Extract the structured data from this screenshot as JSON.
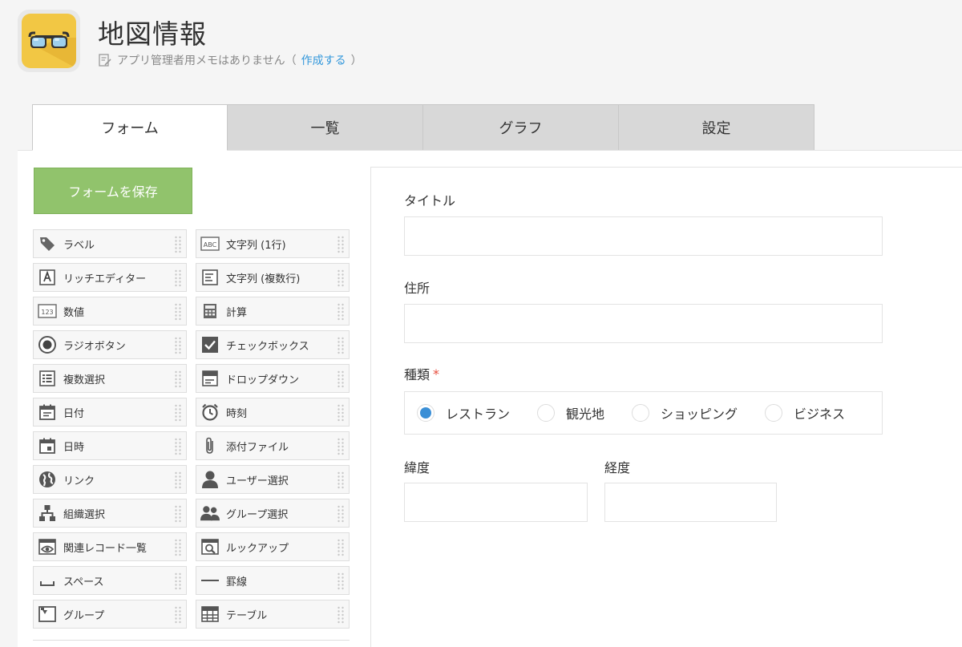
{
  "header": {
    "app_title": "地図情報",
    "memo_text": "アプリ管理者用メモはありません（",
    "memo_link": "作成する",
    "memo_close": "）"
  },
  "tabs": [
    {
      "label": "フォーム",
      "active": true
    },
    {
      "label": "一覧",
      "active": false
    },
    {
      "label": "グラフ",
      "active": false
    },
    {
      "label": "設定",
      "active": false
    }
  ],
  "toolbar": {
    "save_label": "フォームを保存"
  },
  "palette": [
    {
      "label": "ラベル",
      "icon": "tag-icon"
    },
    {
      "label": "文字列 (1行)",
      "icon": "abc-icon"
    },
    {
      "label": "リッチエディター",
      "icon": "rich-editor-icon"
    },
    {
      "label": "文字列 (複数行)",
      "icon": "multiline-text-icon"
    },
    {
      "label": "数値",
      "icon": "number-icon"
    },
    {
      "label": "計算",
      "icon": "calculator-icon"
    },
    {
      "label": "ラジオボタン",
      "icon": "radio-icon"
    },
    {
      "label": "チェックボックス",
      "icon": "checkbox-icon"
    },
    {
      "label": "複数選択",
      "icon": "multi-select-icon"
    },
    {
      "label": "ドロップダウン",
      "icon": "dropdown-icon"
    },
    {
      "label": "日付",
      "icon": "calendar-icon"
    },
    {
      "label": "時刻",
      "icon": "clock-icon"
    },
    {
      "label": "日時",
      "icon": "datetime-icon"
    },
    {
      "label": "添付ファイル",
      "icon": "paperclip-icon"
    },
    {
      "label": "リンク",
      "icon": "globe-icon"
    },
    {
      "label": "ユーザー選択",
      "icon": "user-icon"
    },
    {
      "label": "組織選択",
      "icon": "org-chart-icon"
    },
    {
      "label": "グループ選択",
      "icon": "group-icon"
    },
    {
      "label": "関連レコード一覧",
      "icon": "related-records-icon"
    },
    {
      "label": "ルックアップ",
      "icon": "lookup-icon"
    },
    {
      "label": "スペース",
      "icon": "space-icon"
    },
    {
      "label": "罫線",
      "icon": "line-icon"
    },
    {
      "label": "グループ",
      "icon": "group-field-icon"
    },
    {
      "label": "テーブル",
      "icon": "table-icon"
    }
  ],
  "form": {
    "title_label": "タイトル",
    "title_value": "",
    "address_label": "住所",
    "address_value": "",
    "type_label": "種類",
    "type_required_mark": "*",
    "type_options": [
      "レストラン",
      "観光地",
      "ショッピング",
      "ビジネス"
    ],
    "type_selected": "レストラン",
    "latitude_label": "緯度",
    "latitude_value": "",
    "longitude_label": "経度",
    "longitude_value": ""
  },
  "colors": {
    "save_button": "#91c36c",
    "radio_selected": "#3b8fd6",
    "link": "#3498db",
    "required": "#e74c3c",
    "app_icon_bg": "#f2c744"
  }
}
